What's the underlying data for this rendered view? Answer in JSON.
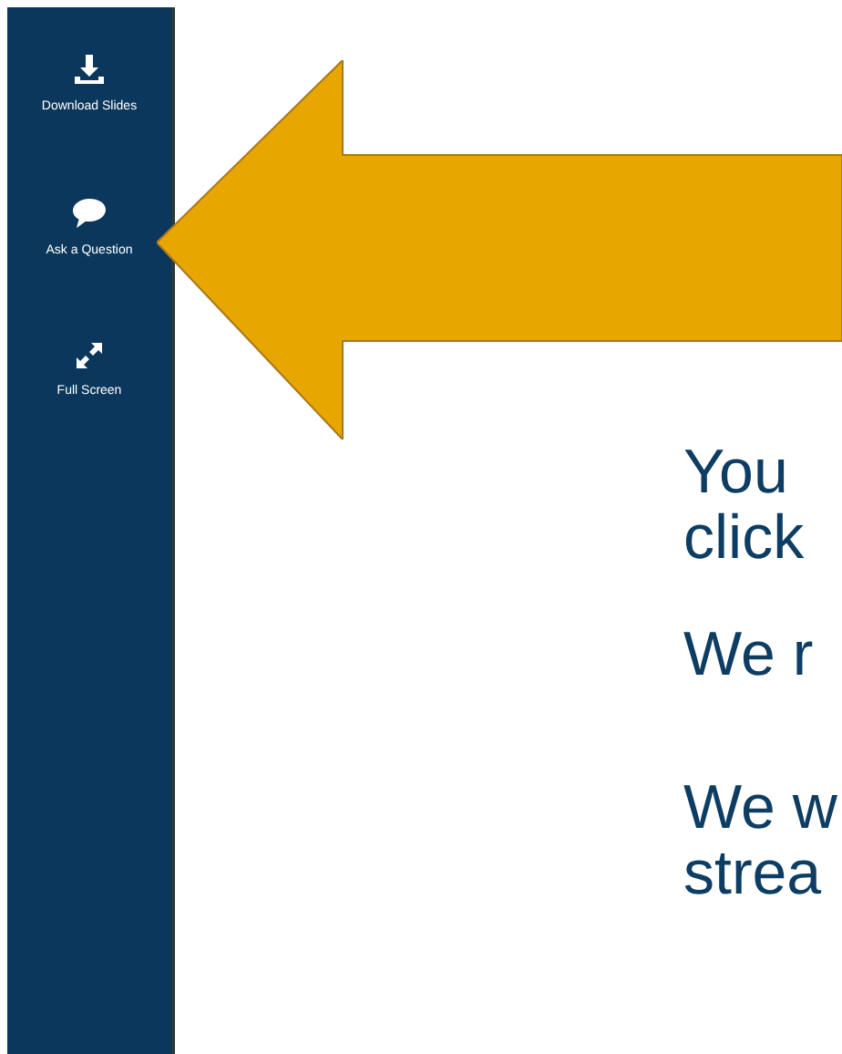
{
  "sidebar": {
    "items": [
      {
        "kind": "download",
        "label": "Download Slides"
      },
      {
        "kind": "chat",
        "label": "Ask a Question"
      },
      {
        "kind": "fullscreen",
        "label": "Full Screen"
      }
    ]
  },
  "slide": {
    "paragraphs": [
      [
        "You",
        "click"
      ],
      [
        "We r"
      ],
      [
        "We w",
        "strea"
      ]
    ]
  }
}
